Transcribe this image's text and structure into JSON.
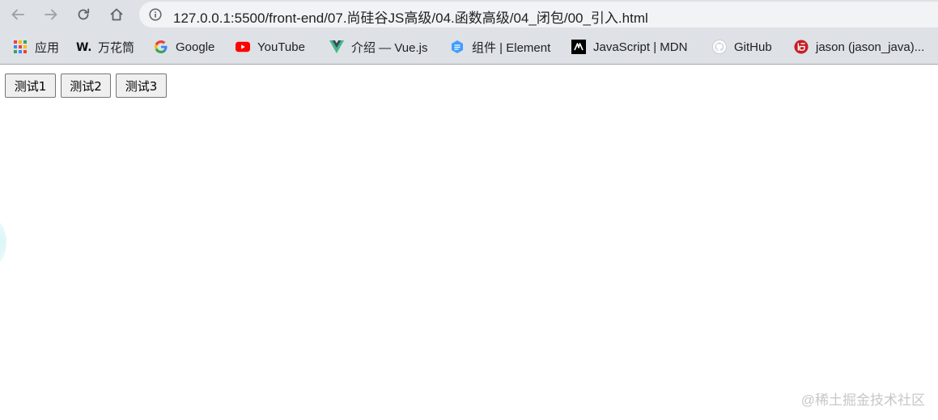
{
  "browser": {
    "url": "127.0.0.1:5500/front-end/07.尚硅谷JS高级/04.函数高级/04_闭包/00_引入.html"
  },
  "bookmarks": [
    {
      "label": "应用",
      "icon": "apps-grid-icon"
    },
    {
      "label": "万花筒",
      "icon": "w-logo-icon"
    },
    {
      "label": "Google",
      "icon": "google-icon"
    },
    {
      "label": "YouTube",
      "icon": "youtube-icon"
    },
    {
      "label": "介绍 — Vue.js",
      "icon": "vue-icon"
    },
    {
      "label": "组件 | Element",
      "icon": "element-icon"
    },
    {
      "label": "JavaScript | MDN",
      "icon": "mdn-icon"
    },
    {
      "label": "GitHub",
      "icon": "github-icon"
    },
    {
      "label": "jason (jason_java)...",
      "icon": "gitee-icon"
    }
  ],
  "page": {
    "buttons": [
      "测试1",
      "测试2",
      "测试3"
    ]
  },
  "watermark": "@稀土掘金技术社区",
  "colors": {
    "chrome_bg": "#dee1e6",
    "omnibox_bg": "#f1f3f4",
    "youtube_red": "#ff0000",
    "vue_green": "#41b883",
    "gitee_red": "#c71d23"
  }
}
